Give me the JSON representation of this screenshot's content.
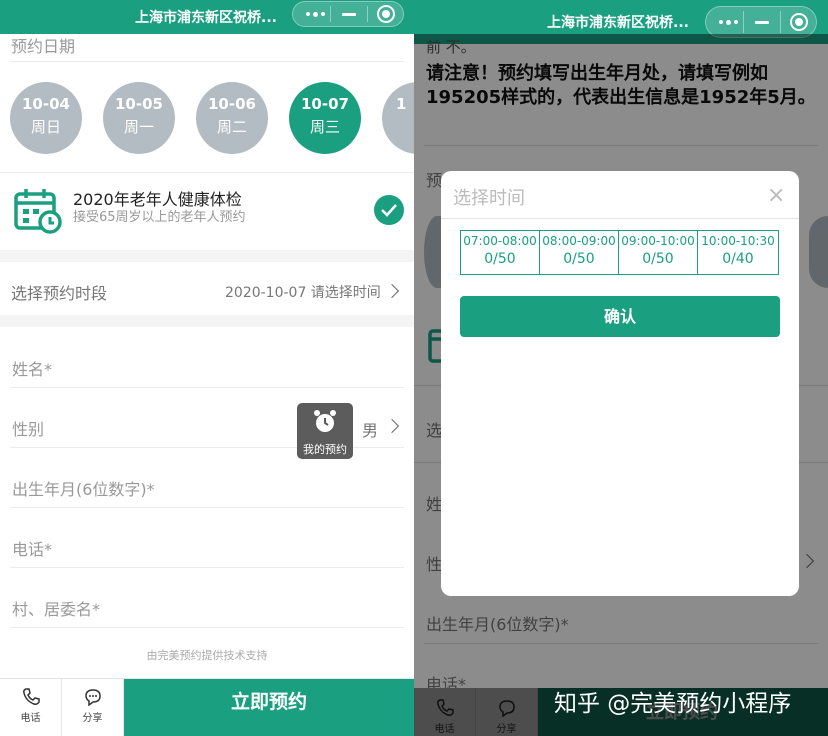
{
  "app": {
    "title": "上海市浦东新区祝桥..."
  },
  "left": {
    "date_section_label": "预约日期",
    "dates": [
      {
        "date": "10-04",
        "weekday": "周日",
        "selected": false
      },
      {
        "date": "10-05",
        "weekday": "周一",
        "selected": false
      },
      {
        "date": "10-06",
        "weekday": "周二",
        "selected": false
      },
      {
        "date": "10-07",
        "weekday": "周三",
        "selected": true
      },
      {
        "date": "1",
        "weekday": "",
        "selected": false
      }
    ],
    "service": {
      "icon": "calendar-clock-icon",
      "title": "2020年老年人健康体检",
      "subtitle": "接受65周岁以上的老年人预约"
    },
    "timeslot": {
      "label": "选择预约时段",
      "value": "2020-10-07 请选择时间"
    },
    "form": {
      "name_label": "姓名*",
      "gender_label": "性别",
      "gender_value": "男",
      "birth_label": "出生年月(6位数字)*",
      "phone_label": "电话*",
      "village_label": "村、居委名*"
    },
    "floating_button": {
      "icon": "alarm-clock-icon",
      "label": "我的预约"
    },
    "powered_by": "由完美预约提供技术支持",
    "bottom": {
      "phone_label": "电话",
      "share_label": "分享",
      "book_label": "立即预约"
    }
  },
  "right": {
    "notice_top": "前 不。",
    "notice": "请注意！预约填写出生年月处，请填写例如195205样式的，代表出生信息是1952年5月。",
    "bg_labels": {
      "date_label_fragment": "预",
      "timeslot_fragment": "选",
      "name_fragment": "姓",
      "gender_fragment": "性",
      "birth_label": "出生年月(6位数字)*",
      "phone_label": "电话*"
    },
    "modal": {
      "title": "选择时间",
      "close": "×",
      "slots": [
        {
          "time": "07:00-08:00",
          "count": "0/50"
        },
        {
          "time": "08:00-09:00",
          "count": "0/50"
        },
        {
          "time": "09:00-10:00",
          "count": "0/50"
        },
        {
          "time": "10:00-10:30",
          "count": "0/40"
        }
      ],
      "confirm_label": "确认"
    },
    "bottom": {
      "phone_label": "电话",
      "share_label": "分享",
      "book_label": "立即预约"
    },
    "watermark": "知乎 @完美预约小程序"
  },
  "colors": {
    "brand": "#1a9f80",
    "date_inactive": "#b3bcc3"
  }
}
